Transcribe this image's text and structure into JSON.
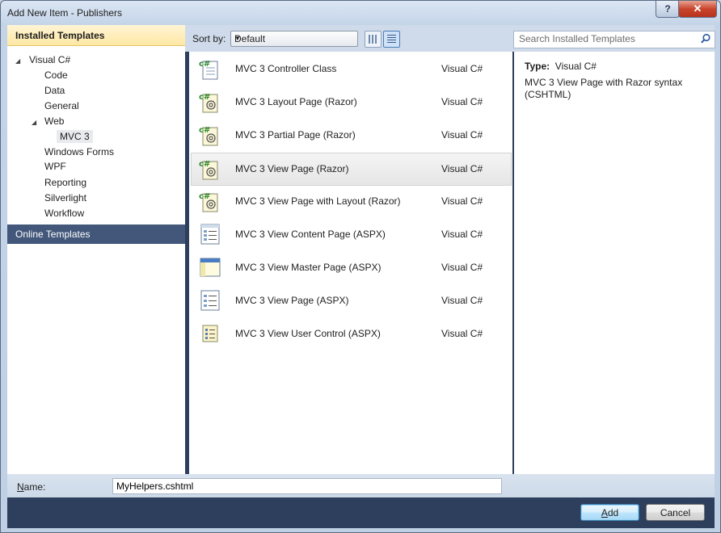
{
  "window": {
    "title": "Add New Item - Publishers",
    "help_label": "?",
    "close_label": "✕"
  },
  "sidebar": {
    "header": "Installed Templates",
    "tree": {
      "root": "Visual C#",
      "items": [
        "Code",
        "Data",
        "General",
        "Web",
        "MVC 3",
        "Windows Forms",
        "WPF",
        "Reporting",
        "Silverlight",
        "Workflow"
      ]
    },
    "online": "Online Templates"
  },
  "toolbar": {
    "sort_label": "Sort by:",
    "sort_value": "Default",
    "search_placeholder": "Search Installed Templates"
  },
  "templates": [
    {
      "name": "MVC 3 Controller Class",
      "lang": "Visual C#",
      "icon": "csharp-class-icon"
    },
    {
      "name": "MVC 3 Layout Page (Razor)",
      "lang": "Visual C#",
      "icon": "razor-page-icon"
    },
    {
      "name": "MVC 3 Partial Page (Razor)",
      "lang": "Visual C#",
      "icon": "razor-page-icon"
    },
    {
      "name": "MVC 3 View Page (Razor)",
      "lang": "Visual C#",
      "icon": "razor-page-icon",
      "selected": true
    },
    {
      "name": "MVC 3 View Page with Layout (Razor)",
      "lang": "Visual C#",
      "icon": "razor-page-icon"
    },
    {
      "name": "MVC 3 View Content Page (ASPX)",
      "lang": "Visual C#",
      "icon": "aspx-content-icon"
    },
    {
      "name": "MVC 3 View Master Page (ASPX)",
      "lang": "Visual C#",
      "icon": "aspx-master-icon"
    },
    {
      "name": "MVC 3 View Page (ASPX)",
      "lang": "Visual C#",
      "icon": "aspx-page-icon"
    },
    {
      "name": "MVC 3 View User Control (ASPX)",
      "lang": "Visual C#",
      "icon": "aspx-control-icon"
    }
  ],
  "details": {
    "type_label": "Type:",
    "type_value": "Visual C#",
    "description": "MVC 3 View Page with Razor syntax (CSHTML)"
  },
  "name_field": {
    "label_underlined": "N",
    "label_rest": "ame:",
    "value": "MyHelpers.cshtml"
  },
  "buttons": {
    "add_underlined": "A",
    "add_rest": "dd",
    "cancel": "Cancel"
  }
}
